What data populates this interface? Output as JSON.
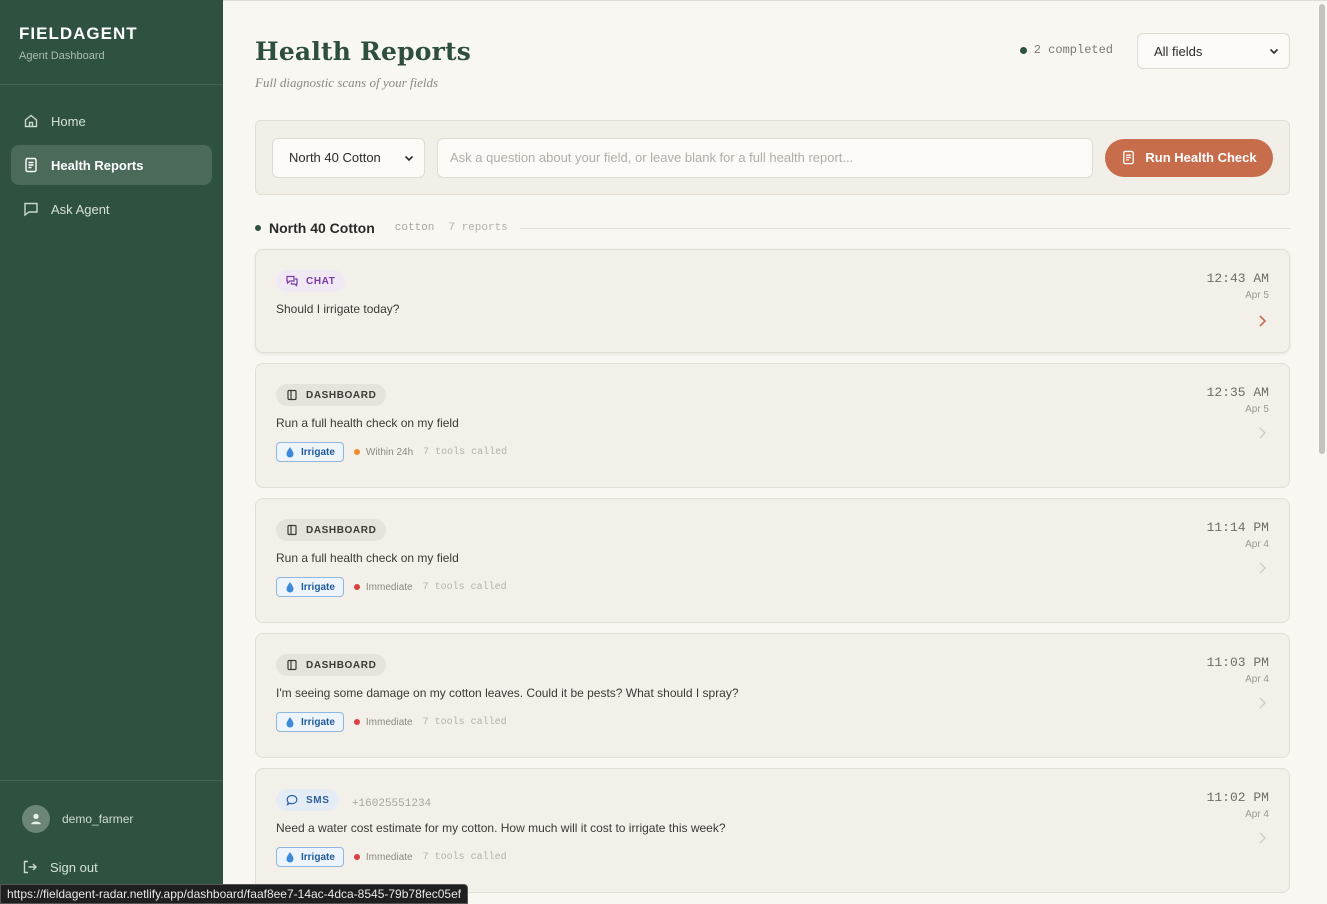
{
  "brand": {
    "title": "FIELDAGENT",
    "subtitle": "Agent Dashboard"
  },
  "nav": [
    {
      "label": "Home",
      "icon": "home-icon",
      "active": false
    },
    {
      "label": "Health Reports",
      "icon": "report-icon",
      "active": true
    },
    {
      "label": "Ask Agent",
      "icon": "chat-icon",
      "active": false
    }
  ],
  "user": {
    "name": "demo_farmer",
    "signout": "Sign out"
  },
  "header": {
    "title": "Health Reports",
    "subtitle": "Full diagnostic scans of your fields",
    "completed": "2 completed",
    "filter": "All fields"
  },
  "run": {
    "field": "North 40 Cotton",
    "placeholder": "Ask a question about your field, or leave blank for a full health report...",
    "button": "Run Health Check"
  },
  "group": {
    "name": "North 40 Cotton",
    "crop": "cotton",
    "count": "7 reports"
  },
  "reports": [
    {
      "type": "CHAT",
      "question": "Should I irrigate today?",
      "time": "12:43 AM",
      "date": "Apr 5"
    },
    {
      "type": "DASHBOARD",
      "question": "Run a full health check on my field",
      "time": "12:35 AM",
      "date": "Apr 5",
      "action": "Irrigate",
      "urgency": "Within 24h",
      "tools": "7 tools called"
    },
    {
      "type": "DASHBOARD",
      "question": "Run a full health check on my field",
      "time": "11:14 PM",
      "date": "Apr 4",
      "action": "Irrigate",
      "urgency": "Immediate",
      "tools": "7 tools called"
    },
    {
      "type": "DASHBOARD",
      "question": "I'm seeing some damage on my cotton leaves. Could it be pests? What should I spray?",
      "time": "11:03 PM",
      "date": "Apr 4",
      "action": "Irrigate",
      "urgency": "Immediate",
      "tools": "7 tools called"
    },
    {
      "type": "SMS",
      "phone": "+16025551234",
      "question": "Need a water cost estimate for my cotton. How much will it cost to irrigate this week?",
      "time": "11:02 PM",
      "date": "Apr 4",
      "action": "Irrigate",
      "urgency": "Immediate",
      "tools": "7 tools called"
    }
  ],
  "status_url": "https://fieldagent-radar.netlify.app/dashboard/faaf8ee7-14ac-4dca-8545-79b78fec05ef",
  "colors": {
    "sidebar": "#2f5140",
    "accent": "#c76d4c",
    "within24h": "#f28c28",
    "immediate": "#d94040"
  }
}
